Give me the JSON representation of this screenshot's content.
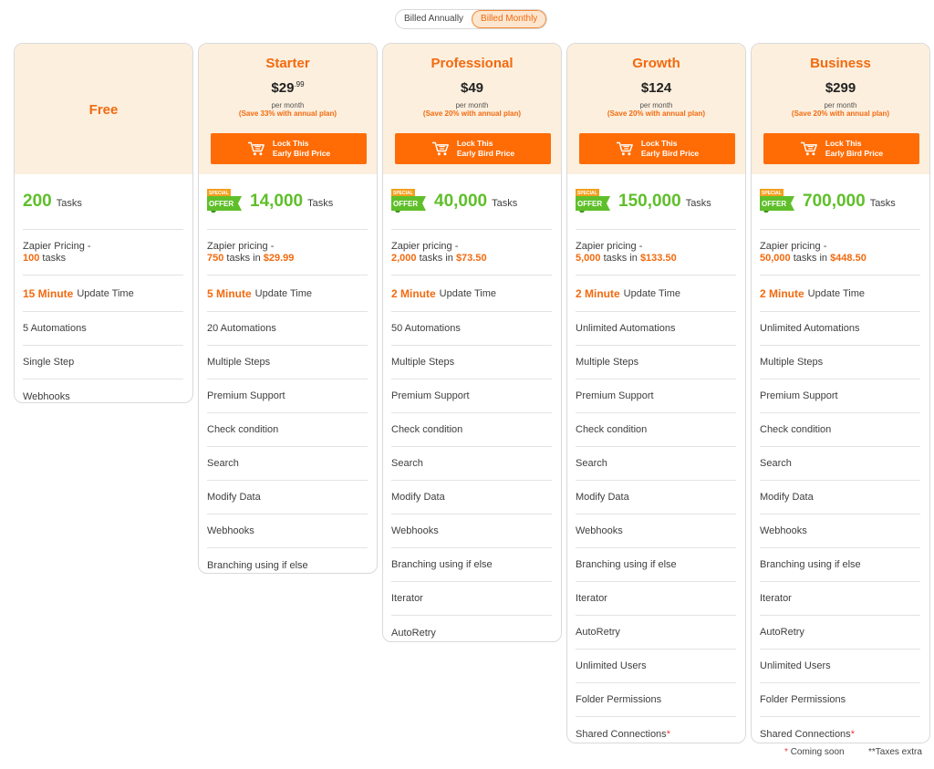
{
  "billing_toggle": {
    "annual": "Billed Annually",
    "monthly": "Billed Monthly",
    "selected": "monthly"
  },
  "colors": {
    "accent": "#f26a0f",
    "button": "#ff6c06",
    "header_bg": "#fcefde",
    "tasks_green": "#5fbf2a"
  },
  "plans": [
    {
      "name": "Free",
      "tasks": "200",
      "tasks_label": "Tasks",
      "zapier_line1": "Zapier Pricing -",
      "zapier_tasks": "100",
      "zapier_tasks_suffix": " tasks",
      "zapier_price": "",
      "zapier_price_prefix": "",
      "update_value": "15 Minute",
      "update_label": "Update Time",
      "features": [
        "5 Automations",
        "Single Step",
        "Webhooks"
      ]
    },
    {
      "name": "Starter",
      "price": "$29",
      "price_cents": ".99",
      "per": "per month",
      "save": "(Save 33% with annual plan)",
      "cta_line1": "Lock This",
      "cta_line2": "Early Bird Price",
      "offer_top": "SPECIAL",
      "offer_text": "OFFER",
      "tasks": "14,000",
      "tasks_label": "Tasks",
      "zapier_line1": "Zapier pricing -",
      "zapier_tasks": "750",
      "zapier_tasks_suffix": " tasks in ",
      "zapier_price": "$29.99",
      "update_value": "5 Minute",
      "update_label": "Update Time",
      "features": [
        "20 Automations",
        "Multiple Steps",
        "Premium Support",
        "Check condition",
        "Search",
        "Modify Data",
        "Webhooks",
        "Branching using if else"
      ]
    },
    {
      "name": "Professional",
      "price": "$49",
      "price_cents": "",
      "per": "per month",
      "save": "(Save 20% with annual plan)",
      "cta_line1": "Lock This",
      "cta_line2": "Early Bird Price",
      "offer_top": "SPECIAL",
      "offer_text": "OFFER",
      "tasks": "40,000",
      "tasks_label": "Tasks",
      "zapier_line1": "Zapier pricing -",
      "zapier_tasks": "2,000",
      "zapier_tasks_suffix": " tasks in ",
      "zapier_price": "$73.50",
      "update_value": "2 Minute",
      "update_label": "Update Time",
      "features": [
        "50 Automations",
        "Multiple Steps",
        "Premium Support",
        "Check condition",
        "Search",
        "Modify Data",
        "Webhooks",
        "Branching using if else",
        "Iterator",
        "AutoRetry"
      ]
    },
    {
      "name": "Growth",
      "price": "$124",
      "price_cents": "",
      "per": "per month",
      "save": "(Save 20% with annual plan)",
      "cta_line1": "Lock This",
      "cta_line2": "Early Bird Price",
      "offer_top": "SPECIAL",
      "offer_text": "OFFER",
      "tasks": "150,000",
      "tasks_label": "Tasks",
      "zapier_line1": "Zapier pricing -",
      "zapier_tasks": "5,000",
      "zapier_tasks_suffix": " tasks in ",
      "zapier_price": "$133.50",
      "update_value": "2 Minute",
      "update_label": "Update Time",
      "features": [
        "Unlimited Automations",
        "Multiple Steps",
        "Premium Support",
        "Check condition",
        "Search",
        "Modify Data",
        "Webhooks",
        "Branching using if else",
        "Iterator",
        "AutoRetry",
        "Unlimited Users",
        "Folder Permissions",
        "Shared Connections"
      ]
    },
    {
      "name": "Business",
      "price": "$299",
      "price_cents": "",
      "per": "per month",
      "save": "(Save 20% with annual plan)",
      "cta_line1": "Lock This",
      "cta_line2": "Early Bird Price",
      "offer_top": "SPECIAL",
      "offer_text": "OFFER",
      "tasks": "700,000",
      "tasks_label": "Tasks",
      "zapier_line1": "Zapier pricing -",
      "zapier_tasks": "50,000",
      "zapier_tasks_suffix": " tasks in ",
      "zapier_price": "$448.50",
      "update_value": "2 Minute",
      "update_label": "Update Time",
      "features": [
        "Unlimited Automations",
        "Multiple Steps",
        "Premium Support",
        "Check condition",
        "Search",
        "Modify Data",
        "Webhooks",
        "Branching using if else",
        "Iterator",
        "AutoRetry",
        "Unlimited Users",
        "Folder Permissions",
        "Shared Connections"
      ]
    }
  ],
  "coming_soon_feature": "Shared Connections",
  "footer": {
    "star": "*",
    "coming_soon": "Coming soon",
    "taxes": "**Taxes extra"
  }
}
